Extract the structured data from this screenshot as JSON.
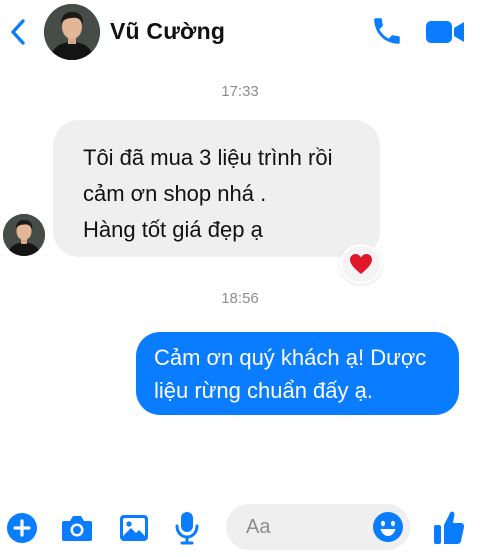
{
  "header": {
    "contact_name": "Vũ Cường",
    "back_icon": "chevron-left-icon",
    "call_icon": "phone-icon",
    "video_icon": "video-camera-icon"
  },
  "conversation": {
    "timestamps": [
      "17:33",
      "18:56"
    ],
    "incoming": {
      "lines": [
        "Tôi đã mua 3 liệu trình rồi",
        "cảm ơn shop nhá .",
        "Hàng tốt giá đẹp ạ"
      ],
      "reaction": "❤️"
    },
    "outgoing": {
      "lines": [
        "Cảm ơn quý khách ạ! Dược",
        "liệu rừng chuẩn đấy ạ."
      ]
    }
  },
  "composer": {
    "placeholder": "Aa",
    "icons": [
      "plus-circle-icon",
      "camera-icon",
      "image-icon",
      "microphone-icon",
      "emoji-icon",
      "thumbs-up-icon"
    ]
  },
  "colors": {
    "accent": "#0a7cff",
    "incoming_bubble": "#efefef",
    "timestamp": "#8a8d91"
  }
}
